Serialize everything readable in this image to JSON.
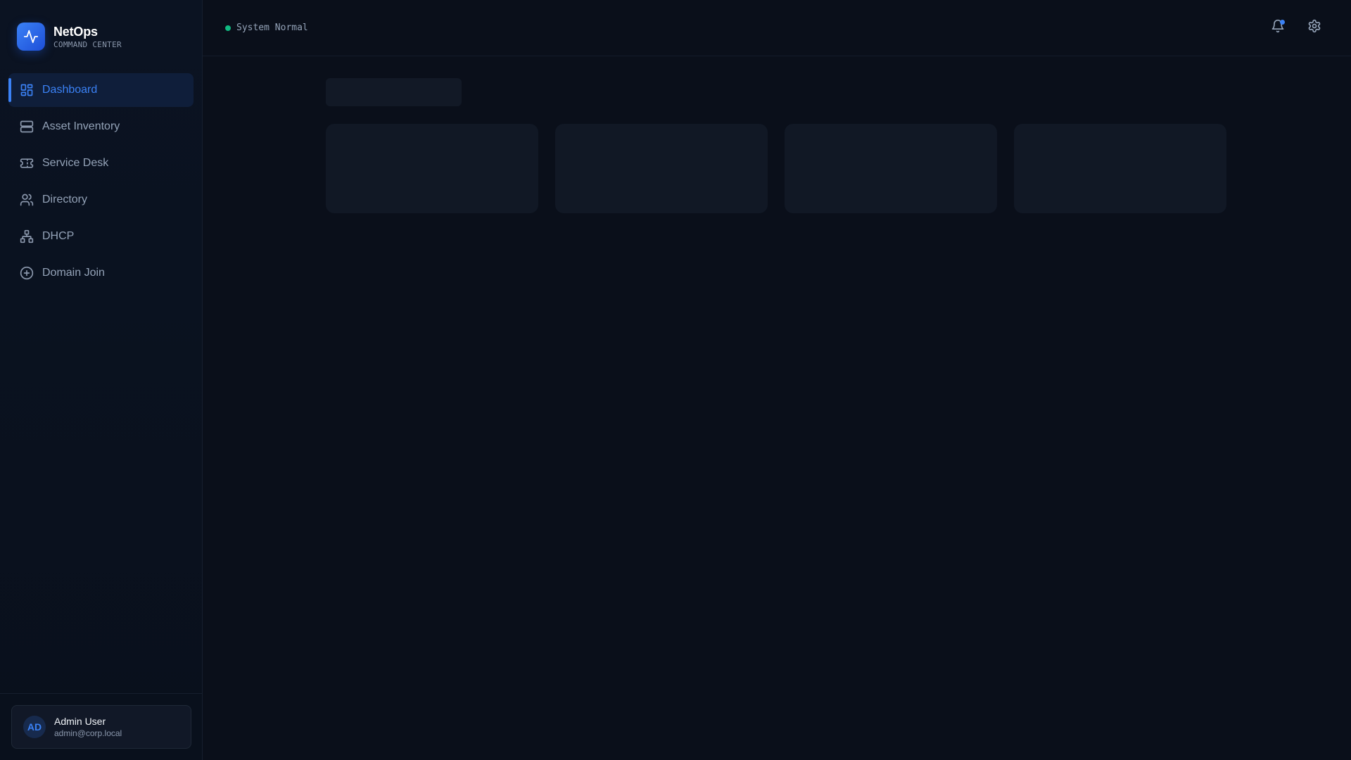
{
  "brand": {
    "name": "NetOps",
    "subtitle": "COMMAND CENTER",
    "icon": "activity-icon",
    "accent_color": "#3b82f6"
  },
  "sidebar": {
    "items": [
      {
        "label": "Dashboard",
        "icon": "layout-dashboard-icon",
        "active": true
      },
      {
        "label": "Asset Inventory",
        "icon": "server-icon",
        "active": false
      },
      {
        "label": "Service Desk",
        "icon": "ticket-icon",
        "active": false
      },
      {
        "label": "Directory",
        "icon": "users-icon",
        "active": false
      },
      {
        "label": "DHCP",
        "icon": "network-icon",
        "active": false
      },
      {
        "label": "Domain Join",
        "icon": "plus-circle-icon",
        "active": false
      }
    ]
  },
  "user": {
    "initials": "AD",
    "name": "Admin User",
    "email": "admin@corp.local"
  },
  "header": {
    "status_text": "System Normal",
    "status_color": "#10b981",
    "notifications_icon": "bell-icon",
    "has_unread": true,
    "settings_icon": "gear-icon"
  },
  "main": {
    "loading": true,
    "skeleton_card_count": 4
  }
}
